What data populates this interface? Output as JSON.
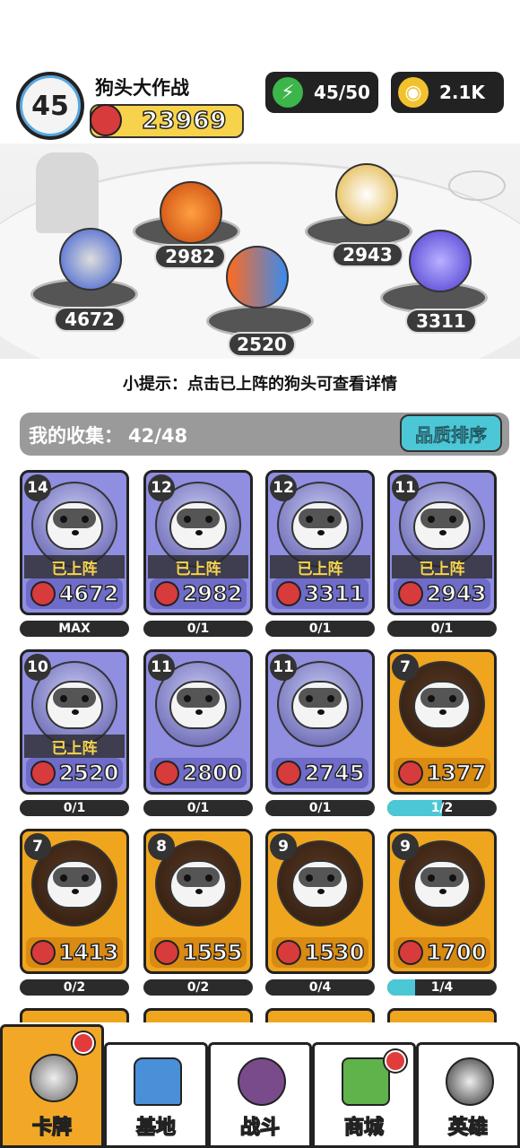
{
  "player": {
    "level": "45",
    "name": "狗头大作战",
    "power": "23969"
  },
  "resources": {
    "energy": "45/50",
    "coins": "2.1K"
  },
  "arena": {
    "lineup": [
      {
        "power": "4672"
      },
      {
        "power": "2982"
      },
      {
        "power": "2520"
      },
      {
        "power": "2943"
      },
      {
        "power": "3311"
      }
    ]
  },
  "tip": "小提示：点击已上阵的狗头可查看详情",
  "collection": {
    "label": "我的收集：",
    "count": "42/48",
    "sort_label": "品质排序"
  },
  "cards": [
    {
      "level": "14",
      "power": "4672",
      "deployed": "已上阵",
      "progress": "MAX",
      "fill": 0,
      "quality": "purple"
    },
    {
      "level": "12",
      "power": "2982",
      "deployed": "已上阵",
      "progress": "0/1",
      "fill": 0,
      "quality": "purple"
    },
    {
      "level": "12",
      "power": "3311",
      "deployed": "已上阵",
      "progress": "0/1",
      "fill": 0,
      "quality": "purple"
    },
    {
      "level": "11",
      "power": "2943",
      "deployed": "已上阵",
      "progress": "0/1",
      "fill": 0,
      "quality": "purple"
    },
    {
      "level": "10",
      "power": "2520",
      "deployed": "已上阵",
      "progress": "0/1",
      "fill": 0,
      "quality": "purple"
    },
    {
      "level": "11",
      "power": "2800",
      "deployed": "",
      "progress": "0/1",
      "fill": 0,
      "quality": "purple"
    },
    {
      "level": "11",
      "power": "2745",
      "deployed": "",
      "progress": "0/1",
      "fill": 0,
      "quality": "purple"
    },
    {
      "level": "7",
      "power": "1377",
      "deployed": "",
      "progress": "1/2",
      "fill": 0.5,
      "quality": "gold"
    },
    {
      "level": "7",
      "power": "1413",
      "deployed": "",
      "progress": "0/2",
      "fill": 0,
      "quality": "gold"
    },
    {
      "level": "8",
      "power": "1555",
      "deployed": "",
      "progress": "0/2",
      "fill": 0,
      "quality": "gold"
    },
    {
      "level": "9",
      "power": "1530",
      "deployed": "",
      "progress": "0/4",
      "fill": 0,
      "quality": "gold"
    },
    {
      "level": "9",
      "power": "1700",
      "deployed": "",
      "progress": "1/4",
      "fill": 0.25,
      "quality": "gold"
    }
  ],
  "nav": [
    {
      "label": "卡牌",
      "icon": "dog-card-icon",
      "active": true,
      "badge": true
    },
    {
      "label": "基地",
      "icon": "castle-icon",
      "active": false,
      "badge": false
    },
    {
      "label": "战斗",
      "icon": "paw-icon",
      "active": false,
      "badge": false
    },
    {
      "label": "商城",
      "icon": "money-icon",
      "active": false,
      "badge": true
    },
    {
      "label": "英雄",
      "icon": "hero-dog-icon",
      "active": false,
      "badge": false
    }
  ],
  "colors": {
    "accent": "#4cc7d6",
    "gold": "#f6d34a",
    "purple_card": "#8f8ee0",
    "gold_card": "#f0a51f",
    "badge": "#e23b3b"
  }
}
